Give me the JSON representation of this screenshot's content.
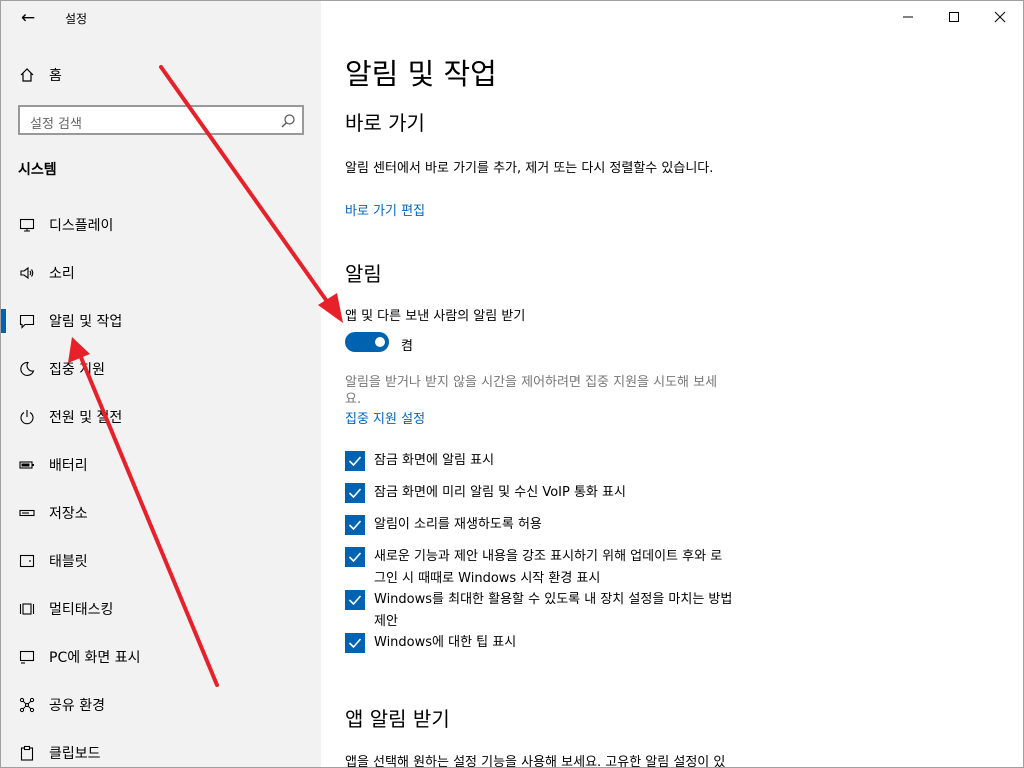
{
  "window": {
    "title": "설정",
    "back_label": "←"
  },
  "sidebar": {
    "home_label": "홈",
    "search_placeholder": "설정 검색",
    "section_title": "시스템",
    "items": [
      {
        "label": "디스플레이",
        "icon": "monitor-icon"
      },
      {
        "label": "소리",
        "icon": "speaker-icon"
      },
      {
        "label": "알림 및 작업",
        "icon": "notification-icon"
      },
      {
        "label": "집중 지원",
        "icon": "moon-icon"
      },
      {
        "label": "전원 및 절전",
        "icon": "power-icon"
      },
      {
        "label": "배터리",
        "icon": "battery-icon"
      },
      {
        "label": "저장소",
        "icon": "storage-icon"
      },
      {
        "label": "태블릿",
        "icon": "tablet-icon"
      },
      {
        "label": "멀티태스킹",
        "icon": "multitasking-icon"
      },
      {
        "label": "PC에 화면 표시",
        "icon": "projecting-icon"
      },
      {
        "label": "공유 환경",
        "icon": "shared-experiences-icon"
      },
      {
        "label": "클립보드",
        "icon": "clipboard-icon"
      }
    ]
  },
  "main": {
    "title": "알림 및 작업",
    "quick_actions": {
      "heading": "바로 가기",
      "description": "알림 센터에서 바로 가기를 추가, 제거 또는 다시 정렬할수 있습니다.",
      "edit_link": "바로 가기 편집"
    },
    "notifications": {
      "heading": "알림",
      "toggle_label": "앱 및 다른 보낸 사람의 알림 받기",
      "toggle_state": "켬",
      "focus_hint_line1": "알림을 받거나 받지 않을 시간을 제어하려면 집중 지원을 시도해 보세",
      "focus_hint_line2": "요.",
      "focus_link": "집중 지원 설정",
      "checkboxes": [
        {
          "line1": "잠금 화면에 알림 표시",
          "line2": ""
        },
        {
          "line1": "잠금 화면에 미리 알림 및 수신 VoIP 통화 표시",
          "line2": ""
        },
        {
          "line1": "알림이 소리를 재생하도록 허용",
          "line2": ""
        },
        {
          "line1": "새로운 기능과 제안 내용을 강조 표시하기 위해 업데이트 후와 로",
          "line2": "그인 시 때때로 Windows 시작 환경 표시"
        },
        {
          "line1": "Windows를 최대한 활용할 수 있도록 내 장치 설정을 마치는 방법",
          "line2": "제안"
        },
        {
          "line1": "Windows에 대한 팁 표시",
          "line2": ""
        }
      ]
    },
    "app_notifications": {
      "heading": "앱 알림 받기",
      "description": "앱을 선택해 원하는 설정 기능을 사용해 보세요. 고유한 알림 설정이 있"
    }
  },
  "colors": {
    "accent": "#0063b1",
    "link": "#0067c0",
    "sidebar_bg": "#f2f2f2",
    "annotation_arrow": "#e8202a"
  }
}
